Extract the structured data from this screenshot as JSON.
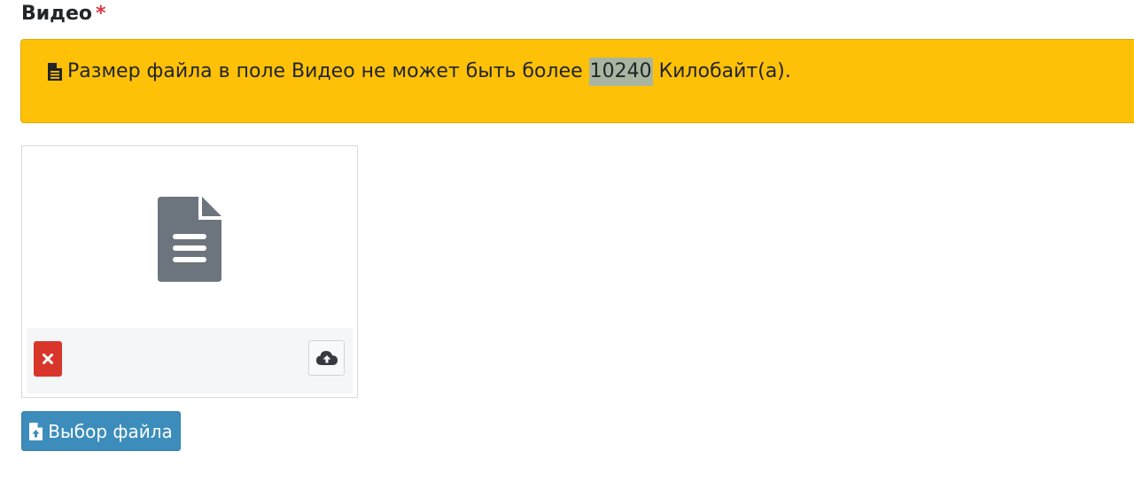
{
  "field": {
    "label": "Видео",
    "required_mark": "*"
  },
  "alert": {
    "icon": "file-text-icon",
    "text_before": "Размер файла в поле Видео не может быть более ",
    "highlight": "10240",
    "text_after": " Килобайт(а).",
    "background_color": "#ffc107"
  },
  "preview": {
    "icon": "file-text-icon",
    "remove_icon": "close-icon",
    "upload_icon": "cloud-upload-icon"
  },
  "choose_button": {
    "icon": "file-upload-icon",
    "label": "Выбор файла",
    "color": "#3c8dbc"
  }
}
